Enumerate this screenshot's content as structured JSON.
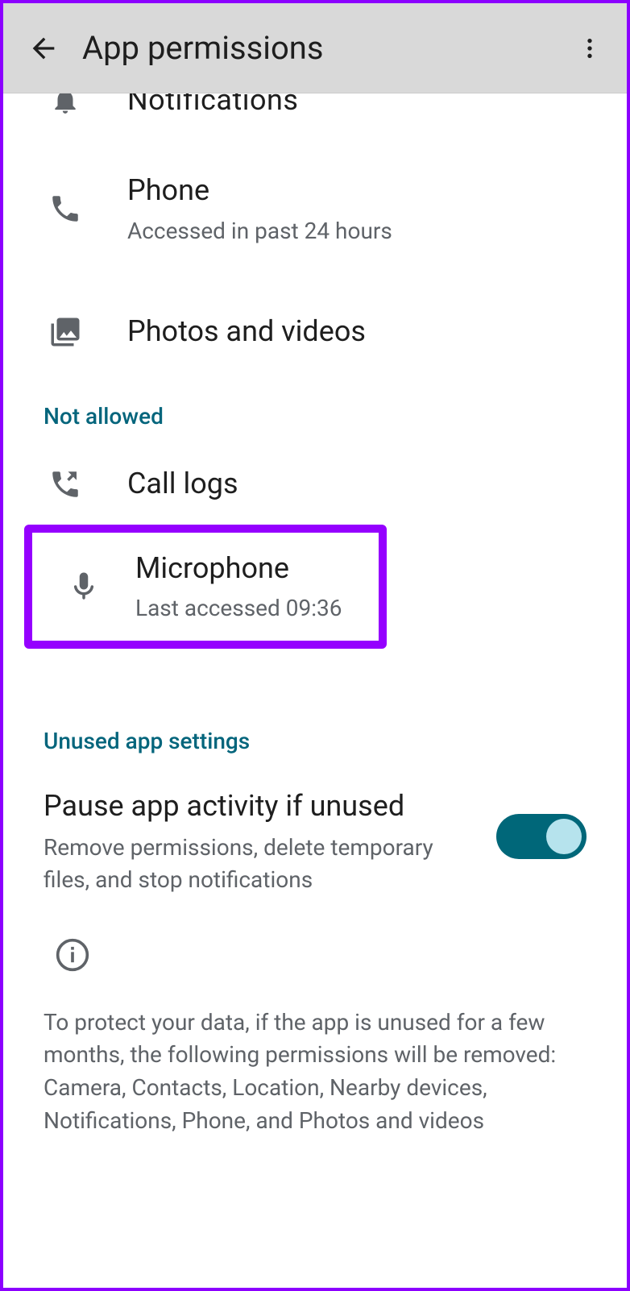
{
  "header": {
    "title": "App permissions"
  },
  "permissions": {
    "notifications": {
      "title": "Notifications"
    },
    "phone": {
      "title": "Phone",
      "subtitle": "Accessed in past 24 hours"
    },
    "photos": {
      "title": "Photos and videos"
    },
    "calllogs": {
      "title": "Call logs"
    },
    "microphone": {
      "title": "Microphone",
      "subtitle": "Last accessed 09:36"
    }
  },
  "sections": {
    "not_allowed": "Not allowed",
    "unused_app": "Unused app settings"
  },
  "pause": {
    "title": "Pause app activity if unused",
    "subtitle": "Remove permissions, delete temporary files, and stop notifications"
  },
  "info": {
    "text": "To protect your data, if the app is unused for a few months, the following permissions will be removed: Camera, Contacts, Location, Nearby devices, Notifications, Phone, and Photos and videos"
  }
}
